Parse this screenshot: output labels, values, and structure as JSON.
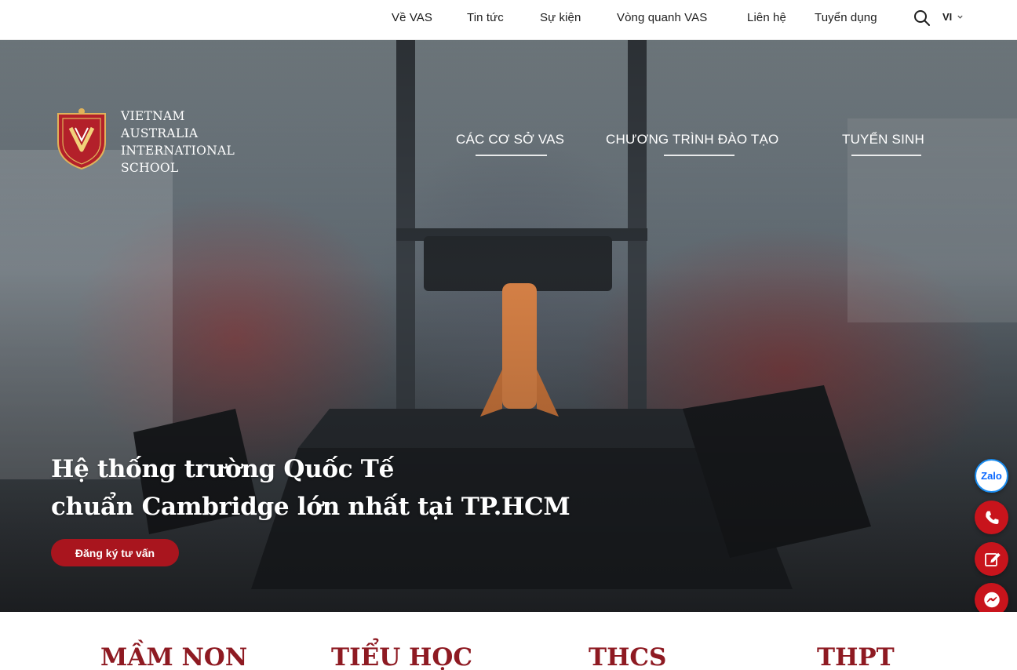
{
  "topbar": {
    "links": [
      "Về VAS",
      "Tin tức",
      "Sự kiện",
      "Vòng quanh VAS",
      "Liên hệ",
      "Tuyển dụng"
    ],
    "search_icon": "search-icon",
    "language": "VI"
  },
  "logo": {
    "lines": [
      "VIETNAM",
      "AUSTRALIA",
      "INTERNATIONAL",
      "SCHOOL"
    ]
  },
  "mainnav": [
    "CÁC CƠ SỞ VAS",
    "CHƯƠNG TRÌNH ĐÀO TẠO",
    "TUYỂN SINH"
  ],
  "hero": {
    "title_line1": "Hệ thống trường Quốc Tế",
    "title_line2": "chuẩn Cambridge lớn nhất tại TP.HCM",
    "cta": "Đăng ký tư vấn"
  },
  "floating": {
    "zalo": "Zalo",
    "icons": [
      "zalo-icon",
      "phone-icon",
      "edit-form-icon",
      "messenger-icon"
    ]
  },
  "levels": [
    "MẦM NON",
    "TIỂU HỌC",
    "THCS",
    "THPT"
  ],
  "colors": {
    "brand_red": "#a9151e",
    "level_text": "#8e1a22",
    "zalo_blue": "#0a68ff"
  }
}
